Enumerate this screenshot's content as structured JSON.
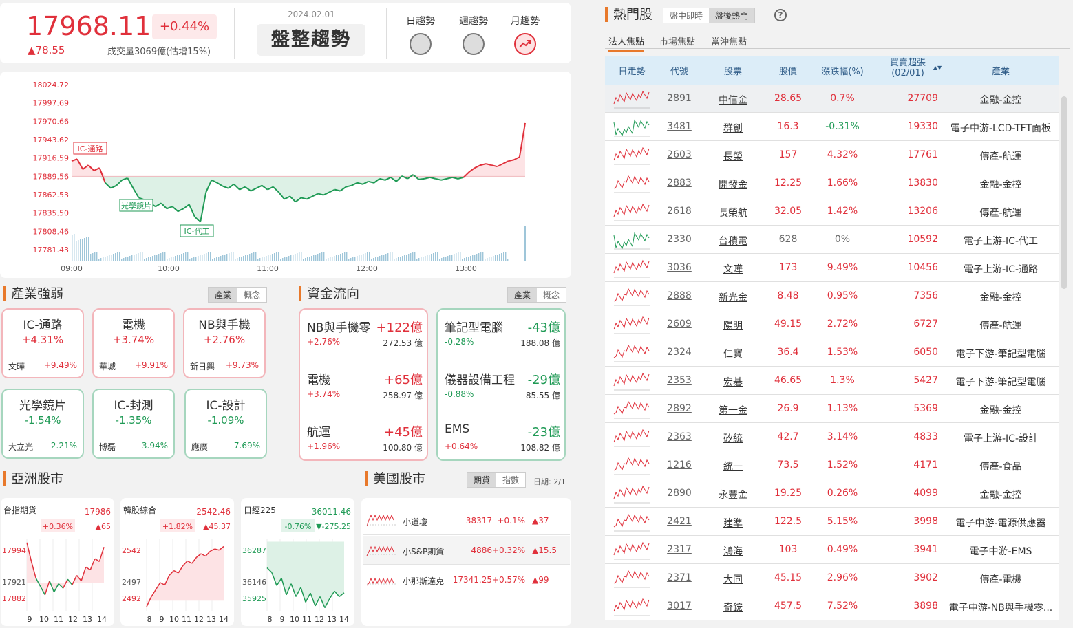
{
  "index": {
    "value": "17968.11",
    "pct": "+0.44%",
    "change": "▲78.55",
    "volume": "成交量3069億(估增15%)",
    "date": "2024.02.01",
    "trend": "盤整趨勢",
    "indicators": [
      {
        "label": "日趨勢",
        "state": "neutral"
      },
      {
        "label": "週趨勢",
        "state": "neutral"
      },
      {
        "label": "月趨勢",
        "state": "up"
      }
    ]
  },
  "chart_data": {
    "type": "line",
    "y_ticks": [
      "18024.72",
      "17997.69",
      "17970.66",
      "17943.62",
      "17916.59",
      "17889.56",
      "17862.53",
      "17835.50",
      "17808.46",
      "17781.43"
    ],
    "x_ticks": [
      "09:00",
      "10:00",
      "11:00",
      "12:00",
      "13:00"
    ],
    "reference": 17889.56,
    "ylim": [
      17781.43,
      18024.72
    ],
    "annotations": [
      "IC-通路",
      "光學鏡片",
      "IC-代工"
    ],
    "points": [
      17912,
      17915,
      17900,
      17906,
      17898,
      17902,
      17880,
      17872,
      17876,
      17884,
      17887,
      17872,
      17858,
      17855,
      17850,
      17845,
      17850,
      17842,
      17845,
      17838,
      17842,
      17848,
      17830,
      17822,
      17866,
      17884,
      17880,
      17875,
      17872,
      17878,
      17870,
      17874,
      17868,
      17872,
      17876,
      17870,
      17874,
      17866,
      17856,
      17860,
      17852,
      17858,
      17856,
      17860,
      17864,
      17862,
      17866,
      17870,
      17868,
      17874,
      17876,
      17880,
      17878,
      17882,
      17880,
      17886,
      17884,
      17888,
      17882,
      17890,
      17886,
      17892,
      17885,
      17886,
      17888,
      17886,
      17884,
      17886,
      17888,
      17886,
      17888,
      17896,
      17902,
      17906,
      17908,
      17906,
      17904,
      17908,
      17912,
      17914,
      17918,
      17968
    ]
  },
  "industry": {
    "title": "產業強弱",
    "tabs": [
      "產業",
      "概念"
    ],
    "items": [
      {
        "name": "IC-通路",
        "pct": "+4.31%",
        "stock": "文曄",
        "spct": "+9.49%",
        "dir": "up"
      },
      {
        "name": "電機",
        "pct": "+3.74%",
        "stock": "華城",
        "spct": "+9.91%",
        "dir": "up"
      },
      {
        "name": "NB與手機",
        "pct": "+2.76%",
        "stock": "新日興",
        "spct": "+9.73%",
        "dir": "up"
      },
      {
        "name": "光學鏡片",
        "pct": "-1.54%",
        "stock": "大立光",
        "spct": "-2.21%",
        "dir": "down"
      },
      {
        "name": "IC-封測",
        "pct": "-1.35%",
        "stock": "博磊",
        "spct": "-3.94%",
        "dir": "down"
      },
      {
        "name": "IC-設計",
        "pct": "-1.09%",
        "stock": "應廣",
        "spct": "-7.69%",
        "dir": "down"
      }
    ]
  },
  "capital": {
    "title": "資金流向",
    "tabs": [
      "產業",
      "概念"
    ],
    "inflow": [
      {
        "name": "NB與手機零",
        "amount": "+122億",
        "pct": "+2.76%",
        "value": "272.53 億"
      },
      {
        "name": "電機",
        "amount": "+65億",
        "pct": "+3.74%",
        "value": "258.97 億"
      },
      {
        "name": "航運",
        "amount": "+45億",
        "pct": "+1.96%",
        "value": "100.80 億"
      }
    ],
    "outflow": [
      {
        "name": "筆記型電腦",
        "amount": "-43億",
        "pct": "-0.28%",
        "value": "188.08 億"
      },
      {
        "name": "儀器設備工程",
        "amount": "-29億",
        "pct": "-0.88%",
        "value": "85.55 億"
      },
      {
        "name": "EMS",
        "amount": "-23億",
        "pct": "+0.64%",
        "value": "108.82 億"
      }
    ]
  },
  "asia": {
    "title": "亞洲股市",
    "markets": [
      {
        "name": "台指期貨",
        "price": "17986",
        "pct": "+0.36%",
        "chg": "▲65",
        "dir": "up",
        "yt": [
          "17994",
          "17921",
          "17882"
        ],
        "xt": [
          "9",
          "10",
          "11",
          "12",
          "13",
          "14"
        ]
      },
      {
        "name": "韓股綜合",
        "price": "2542.46",
        "pct": "+1.82%",
        "chg": "▲45.37",
        "dir": "up",
        "yt": [
          "2542",
          "2497",
          "2492"
        ],
        "xt": [
          "8",
          "9",
          "10",
          "11",
          "12",
          "13",
          "14"
        ]
      },
      {
        "name": "日經225",
        "price": "36011.46",
        "pct": "-0.76%",
        "chg": "▼-275.25",
        "dir": "down",
        "yt": [
          "36287",
          "36146",
          "35925"
        ],
        "xt": [
          "8",
          "9",
          "10",
          "11",
          "12",
          "13",
          "14"
        ]
      }
    ]
  },
  "us": {
    "title": "美國股市",
    "tabs": [
      "期貨",
      "指數"
    ],
    "date": "日期: 2/1",
    "rows": [
      {
        "name": "小道瓊",
        "price": "38317",
        "pct": "+0.1%",
        "chg": "▲37"
      },
      {
        "name": "小S&P期貨",
        "price": "4886",
        "pct": "+0.32%",
        "chg": "▲15.5"
      },
      {
        "name": "小那斯達克",
        "price": "17341.25",
        "pct": "+0.57%",
        "chg": "▲99"
      }
    ]
  },
  "hot": {
    "title": "熱門股",
    "seg": [
      "盤中即時",
      "盤後熱門"
    ],
    "help": "?",
    "tabs": [
      "法人焦點",
      "市場焦點",
      "當沖焦點"
    ],
    "headers": [
      "日走勢",
      "代號",
      "股票",
      "股價",
      "漲跌幅(%)",
      "買賣超張",
      "(02/01)",
      "產業"
    ],
    "sort_icon": "▲▼",
    "rows": [
      {
        "code": "2891",
        "name": "中信金",
        "price": "28.65",
        "pct": "0.7%",
        "vol": "27709",
        "ind": "金融-金控"
      },
      {
        "code": "3481",
        "name": "群創",
        "price": "16.3",
        "pct": "-0.31%",
        "vol": "19330",
        "ind": "電子中游-LCD-TFT面板"
      },
      {
        "code": "2603",
        "name": "長榮",
        "price": "157",
        "pct": "4.32%",
        "vol": "17761",
        "ind": "傳產-航運"
      },
      {
        "code": "2883",
        "name": "開發金",
        "price": "12.25",
        "pct": "1.66%",
        "vol": "13830",
        "ind": "金融-金控"
      },
      {
        "code": "2618",
        "name": "長榮航",
        "price": "32.05",
        "pct": "1.42%",
        "vol": "13206",
        "ind": "傳產-航運"
      },
      {
        "code": "2330",
        "name": "台積電",
        "price": "628",
        "pct": "0%",
        "vol": "10592",
        "ind": "電子上游-IC-代工"
      },
      {
        "code": "3036",
        "name": "文曄",
        "price": "173",
        "pct": "9.49%",
        "vol": "10456",
        "ind": "電子上游-IC-通路"
      },
      {
        "code": "2888",
        "name": "新光金",
        "price": "8.48",
        "pct": "0.95%",
        "vol": "7356",
        "ind": "金融-金控"
      },
      {
        "code": "2609",
        "name": "陽明",
        "price": "49.15",
        "pct": "2.72%",
        "vol": "6727",
        "ind": "傳產-航運"
      },
      {
        "code": "2324",
        "name": "仁寶",
        "price": "36.4",
        "pct": "1.53%",
        "vol": "6050",
        "ind": "電子下游-筆記型電腦"
      },
      {
        "code": "2353",
        "name": "宏碁",
        "price": "46.65",
        "pct": "1.3%",
        "vol": "5427",
        "ind": "電子下游-筆記型電腦"
      },
      {
        "code": "2892",
        "name": "第一金",
        "price": "26.9",
        "pct": "1.13%",
        "vol": "5369",
        "ind": "金融-金控"
      },
      {
        "code": "2363",
        "name": "矽統",
        "price": "42.7",
        "pct": "3.14%",
        "vol": "4833",
        "ind": "電子上游-IC-設計"
      },
      {
        "code": "1216",
        "name": "統一",
        "price": "73.5",
        "pct": "1.52%",
        "vol": "4171",
        "ind": "傳產-食品"
      },
      {
        "code": "2890",
        "name": "永豐金",
        "price": "19.25",
        "pct": "0.26%",
        "vol": "4099",
        "ind": "金融-金控"
      },
      {
        "code": "2421",
        "name": "建準",
        "price": "122.5",
        "pct": "5.15%",
        "vol": "3998",
        "ind": "電子中游-電源供應器"
      },
      {
        "code": "2317",
        "name": "鴻海",
        "price": "103",
        "pct": "0.49%",
        "vol": "3941",
        "ind": "電子中游-EMS"
      },
      {
        "code": "2371",
        "name": "大同",
        "price": "45.15",
        "pct": "2.96%",
        "vol": "3902",
        "ind": "傳產-電機"
      },
      {
        "code": "3017",
        "name": "奇鋐",
        "price": "457.5",
        "pct": "7.52%",
        "vol": "3898",
        "ind": "電子中游-NB與手機零..."
      }
    ]
  }
}
